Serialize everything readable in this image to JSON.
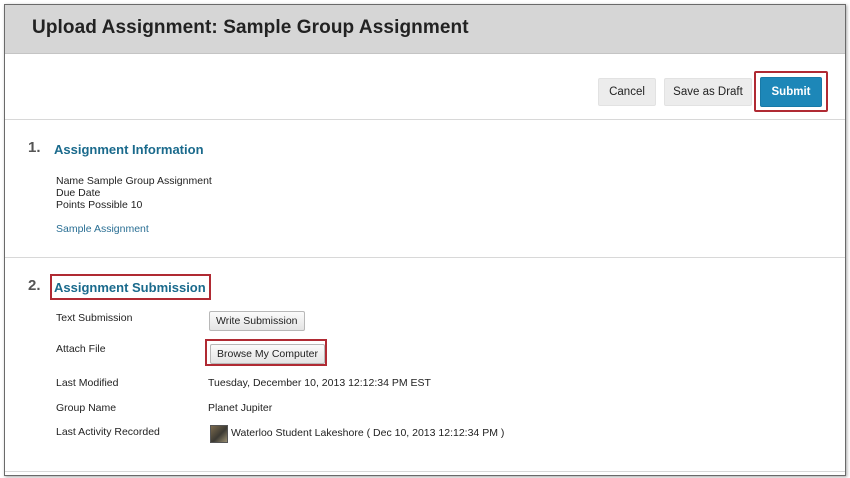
{
  "page": {
    "title": "Upload Assignment: Sample Group Assignment"
  },
  "toolbar": {
    "cancel": "Cancel",
    "save_draft": "Save as Draft",
    "submit": "Submit"
  },
  "section1": {
    "number": "1.",
    "title": "Assignment Information",
    "name_line": "Name Sample Group Assignment",
    "due_line": "Due Date",
    "points_line": "Points Possible 10",
    "link": "Sample Assignment"
  },
  "section2": {
    "number": "2.",
    "title": "Assignment Submission",
    "text_submission_label": "Text Submission",
    "write_submission_button": "Write Submission",
    "attach_file_label": "Attach File",
    "browse_button": "Browse My Computer",
    "last_modified_label": "Last Modified",
    "last_modified_value": "Tuesday, December 10, 2013 12:12:34 PM EST",
    "group_name_label": "Group Name",
    "group_name_value": "Planet Jupiter",
    "last_activity_label": "Last Activity Recorded",
    "last_activity_value": "Waterloo Student Lakeshore ( Dec 10, 2013 12:12:34 PM )"
  },
  "colors": {
    "accent": "#1d87b8",
    "highlight": "#b02a33",
    "section_title": "#1a6a8c"
  }
}
